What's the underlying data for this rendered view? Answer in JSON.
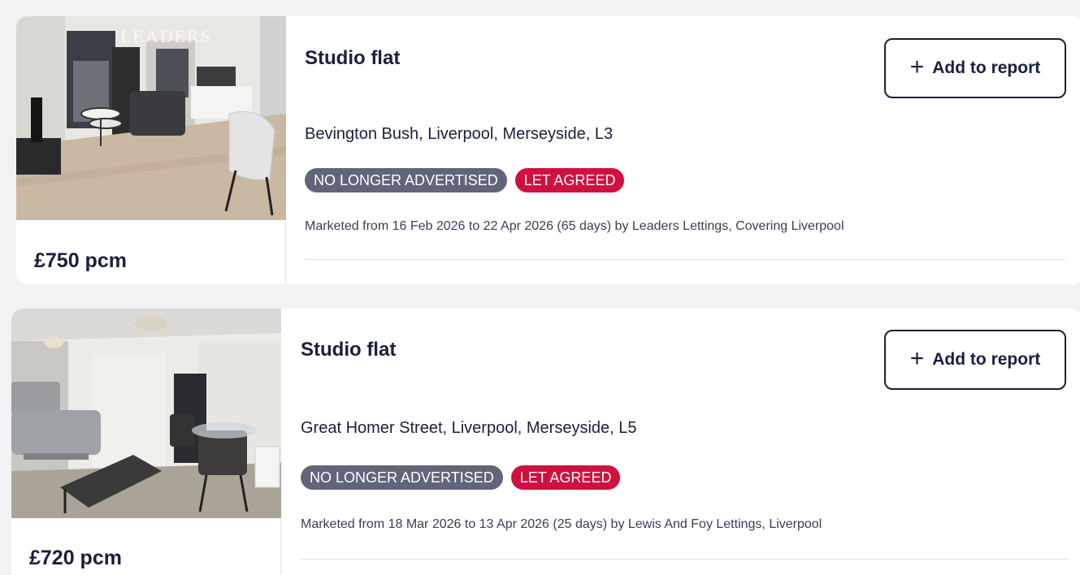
{
  "listings": [
    {
      "title": "Studio flat",
      "add_label": "Add to report",
      "address": "Bevington Bush, Liverpool, Merseyside, L3",
      "badges": {
        "status": "NO LONGER ADVERTISED",
        "agreed": "LET AGREED"
      },
      "marketed": "Marketed from 16 Feb 2026 to 22 Apr 2026 (65 days) by Leaders Lettings, Covering Liverpool",
      "price": "£750 pcm",
      "watermark": "LEADERS"
    },
    {
      "title": "Studio flat",
      "add_label": "Add to report",
      "address": "Great Homer Street, Liverpool, Merseyside, L5",
      "badges": {
        "status": "NO LONGER ADVERTISED",
        "agreed": "LET AGREED"
      },
      "marketed": "Marketed from 18 Mar 2026 to 13 Apr 2026 (25 days) by Lewis And Foy Lettings, Liverpool",
      "price": "£720 pcm"
    }
  ],
  "colors": {
    "navy": "#1b1f3b",
    "badge_grey": "#60657a",
    "badge_red": "#d0103f",
    "background": "#f2f2f4"
  },
  "icons": {
    "add": "plus-icon"
  }
}
